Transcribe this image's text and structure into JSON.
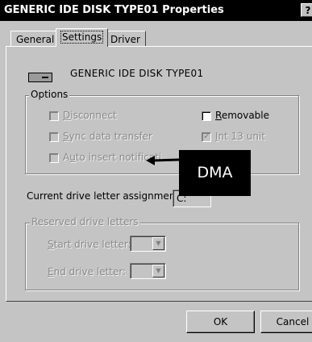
{
  "window": {
    "title": "GENERIC IDE  DISK TYPE01 Properties",
    "help_button": "?"
  },
  "tabs": [
    "General",
    "Settings",
    "Driver"
  ],
  "active_tab": "Settings",
  "device": {
    "name": "GENERIC IDE  DISK TYPE01",
    "icon": "disk-drive-icon"
  },
  "options": {
    "legend": "Options",
    "disconnect": {
      "label": "Disconnect",
      "checked": false,
      "enabled": false
    },
    "sync_data_transfer": {
      "label": "Sync data transfer",
      "checked": false,
      "enabled": false
    },
    "auto_insert_notification": {
      "label": "Auto insert notificati",
      "checked": false,
      "enabled": false
    },
    "removable": {
      "label": "Removable",
      "checked": false,
      "enabled": true
    },
    "int13_unit": {
      "label": "Int 13 unit",
      "checked": true,
      "enabled": false
    }
  },
  "annotation": {
    "label": "DMA"
  },
  "drive_letter": {
    "label": "Current drive letter assignment:",
    "value": "C:"
  },
  "reserved": {
    "legend": "Reserved drive letters",
    "start_label": "Start drive letter:",
    "end_label": "End drive letter:"
  },
  "buttons": {
    "ok": "OK",
    "cancel": "Cancel"
  }
}
